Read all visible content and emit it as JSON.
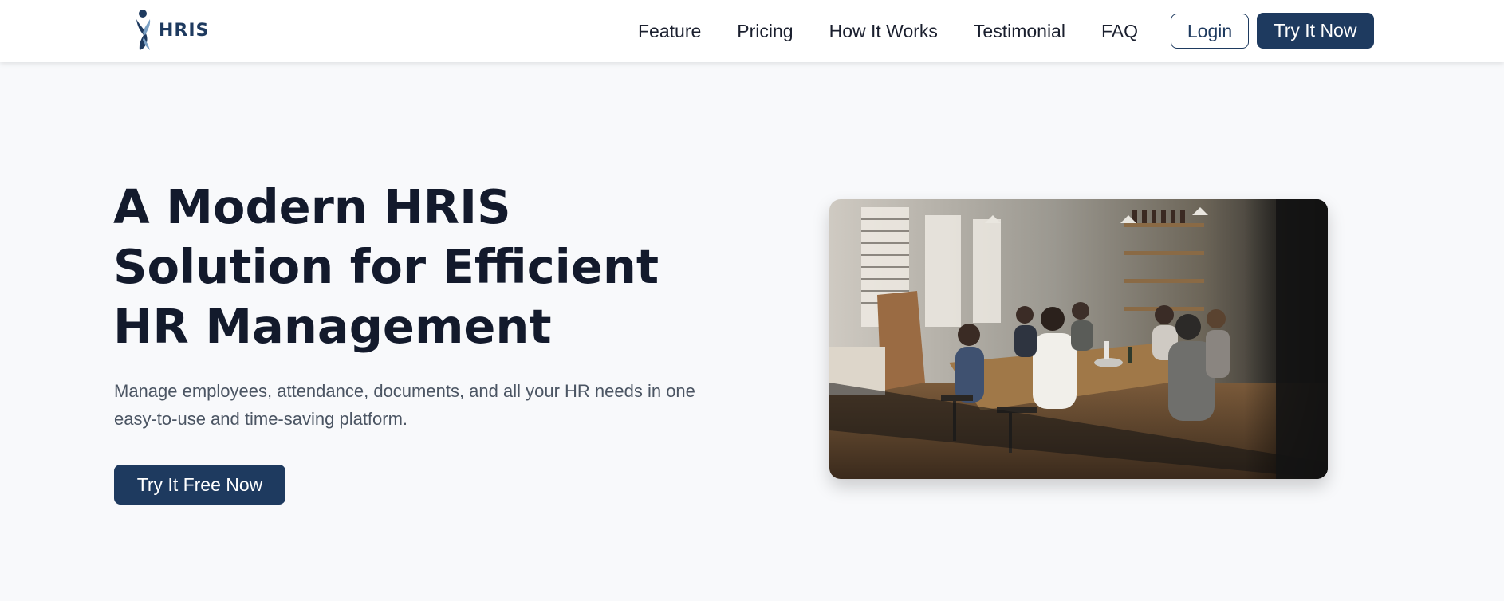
{
  "brand": {
    "name": "HRIS",
    "icon": "hris-logo-icon",
    "color": "#1e3a5f"
  },
  "nav": {
    "links": [
      "Feature",
      "Pricing",
      "How It Works",
      "Testimonial",
      "FAQ"
    ],
    "login_label": "Login",
    "try_label": "Try It Now"
  },
  "hero": {
    "title": "A Modern HRIS Solution for Efficient HR Management",
    "subtitle": "Manage employees, attendance, documents, and all your HR needs in one easy-to-use and time-saving platform.",
    "cta_label": "Try It Free Now",
    "image": "team-meeting-photo"
  },
  "colors": {
    "primary": "#1e3a5f",
    "background": "#f8f9fb",
    "heading": "#131a2c",
    "body_text": "#4b5563"
  }
}
